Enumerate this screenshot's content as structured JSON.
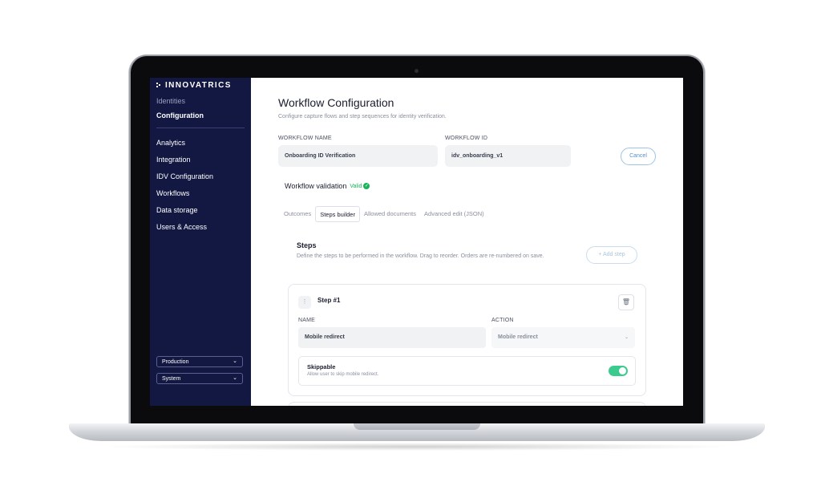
{
  "sidebar": {
    "brand": "INNOVATRICS",
    "muted_item": "Identities",
    "active_item": "Configuration",
    "items": [
      {
        "label": "Analytics"
      },
      {
        "label": "Integration"
      },
      {
        "label": "IDV Configuration"
      },
      {
        "label": "Workflows"
      },
      {
        "label": "Data storage"
      },
      {
        "label": "Users & Access"
      }
    ],
    "environment_select": "Production",
    "system_select": "System"
  },
  "page": {
    "title": "Workflow Configuration",
    "subtitle": "Configure capture flows and step sequences for identity verification."
  },
  "form": {
    "workflow_name_label": "WORKFLOW NAME",
    "workflow_name_value": "Onboarding ID Verification",
    "workflow_id_label": "WORKFLOW ID",
    "workflow_id_value": "idv_onboarding_v1",
    "cancel_label": "Cancel"
  },
  "validation": {
    "label": "Workflow validation",
    "status": "Valid",
    "status_color": "#19b35a"
  },
  "tabs": [
    {
      "label": "Outcomes",
      "active": false
    },
    {
      "label": "Steps builder",
      "active": true
    },
    {
      "label": "Allowed documents",
      "active": false
    },
    {
      "label": "Advanced edit (JSON)",
      "active": false
    }
  ],
  "steps": {
    "title": "Steps",
    "description": "Define the steps to be performed in the workflow. Drag to reorder. Orders are re-numbered on save.",
    "add_step_label": "Add step",
    "items": [
      {
        "title": "Step #1",
        "name_label": "NAME",
        "name_value": "Mobile redirect",
        "action_label": "ACTION",
        "action_value": "Mobile redirect",
        "skippable_label": "Skippable",
        "skippable_desc": "Allow user to skip mobile redirect.",
        "skippable_on": true
      }
    ]
  },
  "colors": {
    "sidebar_bg": "#121842",
    "toggle_on": "#3ccb8f",
    "accent_outline": "#9cc3e8"
  }
}
